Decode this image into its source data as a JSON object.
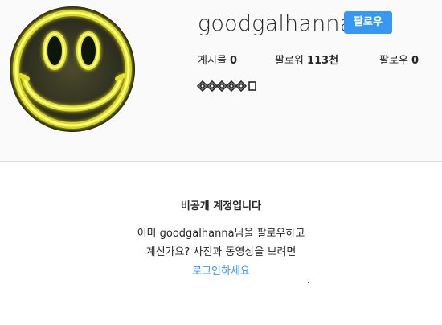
{
  "profile": {
    "username": "goodgalhanna",
    "follow_label": "팔로우",
    "fullname": "ꕥꕥꕥꕥ",
    "avatar_icon": "neon-smiley-icon",
    "accent_color": "#3897f0"
  },
  "stats": {
    "posts_label": "게시물",
    "posts_count": "0",
    "followers_label": "팔로워",
    "followers_count": "113천",
    "following_label": "팔로우",
    "following_count": "0"
  },
  "private_account": {
    "title": "비공개 계정입니다",
    "line1": "이미 goodgalhanna님을 팔로우하고",
    "line2": "계신가요? 사진과 동영상을 보려면",
    "login_link": "로그인하세요"
  }
}
